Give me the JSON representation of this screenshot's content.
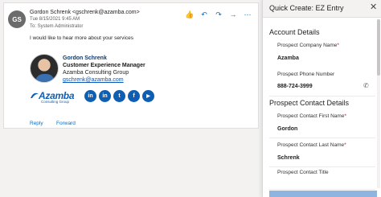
{
  "email": {
    "avatar_initials": "GS",
    "sender": "Gordon Schrenk <gschrenk@azamba.com>",
    "date": "Tue 8/15/2021 9:45 AM",
    "to": "To: System Administrator",
    "body": "I would like to hear more about your services",
    "actions": [
      {
        "icon": "like-icon",
        "glyph": "👍"
      },
      {
        "icon": "reply-icon",
        "glyph": "↶"
      },
      {
        "icon": "reply-all-icon",
        "glyph": "↷"
      },
      {
        "icon": "forward-icon",
        "glyph": "→"
      },
      {
        "icon": "more-icon",
        "glyph": "⋯"
      }
    ],
    "signature": {
      "name": "Gordon Schrenk",
      "role": "Customer Experience Manager",
      "company": "Azamba Consulting Group",
      "email": "gschrenk@azamba.com",
      "logo_word": "Azamba",
      "logo_sub": "Consulting Group",
      "social": [
        {
          "icon": "linkedin-icon",
          "glyph": "in"
        },
        {
          "icon": "linkedin-icon-2",
          "glyph": "in"
        },
        {
          "icon": "twitter-icon",
          "glyph": "t"
        },
        {
          "icon": "facebook-icon",
          "glyph": "f"
        },
        {
          "icon": "youtube-icon",
          "glyph": "▶"
        }
      ]
    },
    "reply_label": "Reply",
    "forward_label": "Forward"
  },
  "panel": {
    "title": "Quick Create: EZ Entry",
    "close_glyph": "✕",
    "sections": {
      "account_title": "Account Details",
      "contact_title": "Prospect Contact Details"
    },
    "fields": {
      "company_label": "Prospect Company Name",
      "company_value": "Azamba",
      "phone_label": "Prospect Phone Number",
      "phone_value": "888-724-3999",
      "first_label": "Prospect Contact First Name",
      "first_value": "Gordon",
      "last_label": "Prospect Contact Last Name",
      "last_value": "Schrenk",
      "title_label": "Prospect Contact Title"
    },
    "required_mark": "*",
    "phone_glyph": "✆"
  },
  "colors": {
    "accent": "#0f6cbd",
    "brand": "#0e5fb4",
    "required": "#a4262c"
  }
}
